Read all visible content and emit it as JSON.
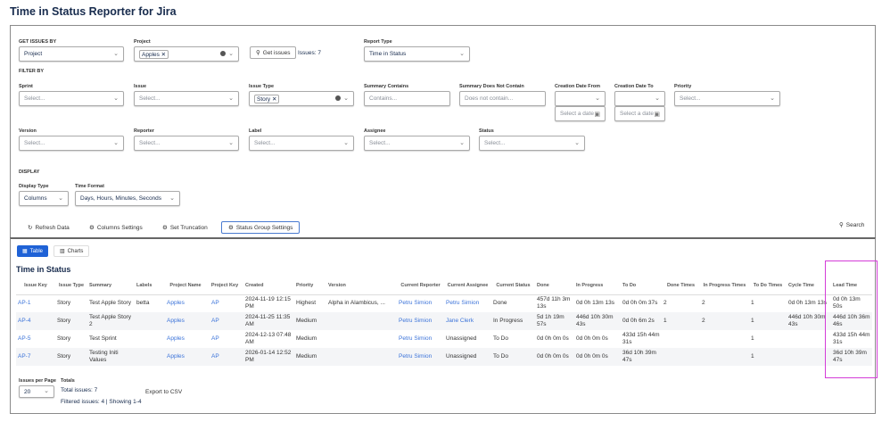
{
  "title": "Time in Status Reporter for Jira",
  "filters": {
    "get_issues_by": {
      "section": "GET ISSUES BY",
      "value": "Project"
    },
    "project": {
      "label": "Project",
      "tag": "Apples"
    },
    "get_issues_button": "Get issues",
    "issues_count": "Issues: 7",
    "report_type": {
      "label": "Report Type",
      "value": "Time in Status"
    },
    "filter_by": "FILTER BY",
    "sprint": {
      "label": "Sprint",
      "placeholder": "Select..."
    },
    "issue": {
      "label": "Issue",
      "placeholder": "Select..."
    },
    "issue_type": {
      "label": "Issue Type",
      "tag": "Story"
    },
    "summary_contains": {
      "label": "Summary Contains",
      "placeholder": "Contains..."
    },
    "summary_not_contain": {
      "label": "Summary Does Not Contain",
      "placeholder": "Does not contain..."
    },
    "creation_from": {
      "label": "Creation Date From",
      "placeholder": "Select a date"
    },
    "creation_to": {
      "label": "Creation Date To",
      "placeholder": "Select a date"
    },
    "priority": {
      "label": "Priority",
      "placeholder": "Select..."
    },
    "version": {
      "label": "Version",
      "placeholder": "Select..."
    },
    "reporter": {
      "label": "Reporter",
      "placeholder": "Select..."
    },
    "label": {
      "label": "Label",
      "placeholder": "Select..."
    },
    "assignee": {
      "label": "Assignee",
      "placeholder": "Select..."
    },
    "status": {
      "label": "Status",
      "placeholder": "Select..."
    }
  },
  "display": {
    "section": "DISPLAY",
    "display_type": {
      "label": "Display Type",
      "value": "Columns"
    },
    "time_format": {
      "label": "Time Format",
      "value": "Days, Hours, Minutes, Seconds"
    }
  },
  "toolbar": {
    "refresh": "Refresh Data",
    "columns": "Columns Settings",
    "truncation": "Set Truncation",
    "status_group": "Status Group Settings",
    "search": "Search"
  },
  "view_tabs": {
    "table": "Table",
    "charts": "Charts"
  },
  "results": {
    "title": "Time in Status",
    "columns": [
      "Issue Key",
      "Issue Type",
      "Summary",
      "Labels",
      "Project Name",
      "Project Key",
      "Created",
      "Priority",
      "Version",
      "Current Reporter",
      "Current Assignee",
      "Current Status",
      "Done",
      "In Progress",
      "To Do",
      "Done Times",
      "In Progress Times",
      "To Do Times",
      "Cycle Time",
      "Lead Time"
    ],
    "rows": [
      [
        "AP-1",
        "Story",
        "Test Apple Story",
        "betta",
        "Apples",
        "AP",
        "2024-11-19 12:15 PM",
        "Highest",
        "Alpha in Alambicus, ...",
        "Petru Simion",
        "Petru Simion",
        "Done",
        "457d 11h 3m 13s",
        "0d 0h 13m 13s",
        "0d 0h 0m 37s",
        "2",
        "2",
        "1",
        "0d 0h 13m 13s",
        "0d 0h 13m 50s"
      ],
      [
        "AP-4",
        "Story",
        "Test Apple Story 2",
        "",
        "Apples",
        "AP",
        "2024-11-25 11:35 AM",
        "Medium",
        "",
        "Petru Simion",
        "Jane Clerk",
        "In Progress",
        "5d 1h 19m 57s",
        "446d 10h 30m 43s",
        "0d 0h 6m 2s",
        "1",
        "2",
        "1",
        "446d 10h 30m 43s",
        "446d 10h 36m 46s"
      ],
      [
        "AP-5",
        "Story",
        "Test Sprint",
        "",
        "Apples",
        "AP",
        "2024-12-13 07:48 AM",
        "Medium",
        "",
        "Petru Simion",
        "Unassigned",
        "To Do",
        "0d 0h 0m 0s",
        "0d 0h 0m 0s",
        "433d 15h 44m 31s",
        "",
        "",
        "1",
        "",
        "433d 15h 44m 31s"
      ],
      [
        "AP-7",
        "Story",
        "Testing Initi Values",
        "",
        "Apples",
        "AP",
        "2026-01-14 12:52 PM",
        "Medium",
        "",
        "Petru Simion",
        "Unassigned",
        "To Do",
        "0d 0h 0m 0s",
        "0d 0h 0m 0s",
        "36d 10h 39m 47s",
        "",
        "",
        "1",
        "",
        "36d 10h 39m 47s"
      ]
    ]
  },
  "footer": {
    "per_page_label": "Issues per Page",
    "per_page": "20",
    "totals_label": "Totals",
    "total_issues": "Total issues: 7",
    "filtered": "Filtered issues: 4 | Showing 1-4",
    "export": "Export to CSV"
  },
  "colors": {
    "link": "#3b73d9",
    "primary": "#1f62d6",
    "highlight": "#d43cd8"
  }
}
